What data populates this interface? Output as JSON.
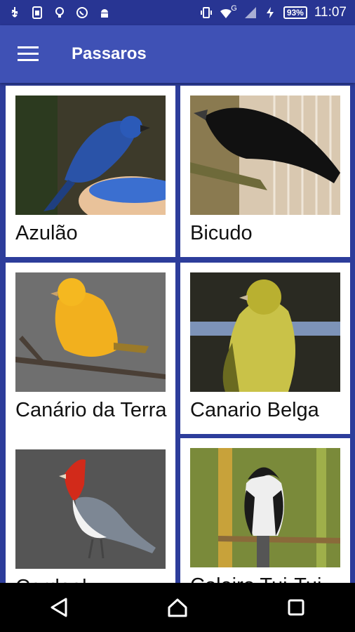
{
  "status_bar": {
    "battery": "93%",
    "network": "G",
    "time": "11:07",
    "icons_left": [
      "usb-icon",
      "sim-card-icon",
      "lightbulb-icon",
      "whatsapp-icon",
      "android-icon"
    ],
    "icons_right": [
      "vibrate-icon",
      "wifi-icon",
      "signal-icon",
      "charging-icon"
    ]
  },
  "app_bar": {
    "title": "Passaros",
    "menu_icon": "hamburger-menu-icon"
  },
  "birds": [
    {
      "name": "Azulão",
      "image": "blue-bird-photo"
    },
    {
      "name": "Bicudo",
      "image": "black-bird-photo"
    },
    {
      "name": "Canário da Terra",
      "image": "yellow-canary-photo"
    },
    {
      "name": "Canario Belga",
      "image": "yellow-green-canary-photo"
    },
    {
      "name": "Cardeal",
      "image": "red-crested-cardinal-photo"
    },
    {
      "name": "Coleiro Tui-Tui",
      "image": "black-white-bird-photo"
    }
  ],
  "nav_bar": {
    "buttons": [
      "back-icon",
      "home-icon",
      "recents-icon"
    ]
  },
  "colors": {
    "primary": "#3f51b5",
    "primary_dark": "#283593",
    "background": "#2d3d9b",
    "card": "#ffffff"
  }
}
